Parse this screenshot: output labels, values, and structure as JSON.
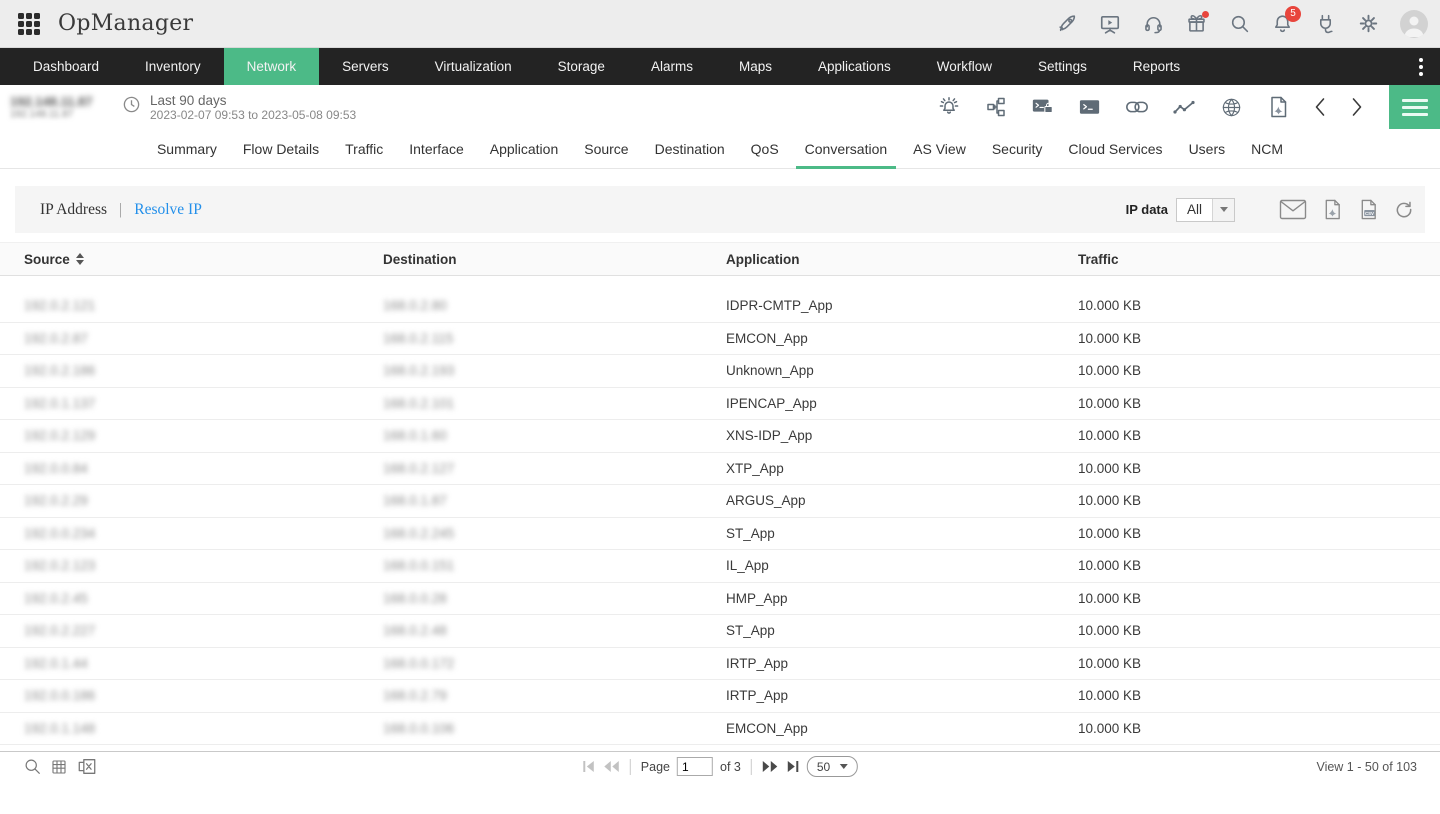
{
  "topbar": {
    "logo": "OpManager",
    "notification_count": "5",
    "icons": [
      "apps-grid-icon",
      "rocket-icon",
      "demo-video-icon",
      "support-headset-icon",
      "gift-icon",
      "search-icon",
      "notification-bell-icon",
      "integrations-plug-icon",
      "settings-gear-icon",
      "user-avatar"
    ]
  },
  "nav": {
    "items": [
      {
        "label": "Dashboard",
        "active": false
      },
      {
        "label": "Inventory",
        "active": false
      },
      {
        "label": "Network",
        "active": true
      },
      {
        "label": "Servers",
        "active": false
      },
      {
        "label": "Virtualization",
        "active": false
      },
      {
        "label": "Storage",
        "active": false
      },
      {
        "label": "Alarms",
        "active": false
      },
      {
        "label": "Maps",
        "active": false
      },
      {
        "label": "Applications",
        "active": false
      },
      {
        "label": "Workflow",
        "active": false
      },
      {
        "label": "Settings",
        "active": false
      },
      {
        "label": "Reports",
        "active": false
      }
    ]
  },
  "device": {
    "name": "192.148.11.87",
    "subtitle": "192.148.11.87",
    "masked": true
  },
  "period": {
    "label": "Last 90 days",
    "range": "2023-02-07 09:53 to 2023-05-08 09:53"
  },
  "subhead_icons": [
    "alarm-config-icon",
    "topology-icon",
    "secure-terminal-icon",
    "terminal-icon",
    "link-icon",
    "traffic-graph-icon",
    "globe-icon",
    "pdf-report-icon",
    "chevron-left-icon",
    "chevron-right-icon",
    "hamburger-menu-icon"
  ],
  "tabs": {
    "items": [
      "Summary",
      "Flow Details",
      "Traffic",
      "Interface",
      "Application",
      "Source",
      "Destination",
      "QoS",
      "Conversation",
      "AS View",
      "Security",
      "Cloud Services",
      "Users",
      "NCM"
    ],
    "active": "Conversation"
  },
  "filter": {
    "ip_address_label": "IP Address",
    "resolve_ip_label": "Resolve IP",
    "ip_data_label": "IP data",
    "ip_data_value": "All",
    "icons": [
      "mail-icon",
      "pdf-export-icon",
      "csv-export-icon",
      "refresh-icon"
    ]
  },
  "table": {
    "columns": [
      "Source",
      "Destination",
      "Application",
      "Traffic"
    ],
    "sorted_by": "Source",
    "masked_columns": [
      "Source",
      "Destination"
    ],
    "rows": [
      {
        "source": "192.0.2.121",
        "destination": "168.0.2.80",
        "application": "IDPR-CMTP_App",
        "traffic": "10.000 KB"
      },
      {
        "source": "192.0.2.87",
        "destination": "168.0.2.115",
        "application": "EMCON_App",
        "traffic": "10.000 KB"
      },
      {
        "source": "192.0.2.186",
        "destination": "168.0.2.193",
        "application": "Unknown_App",
        "traffic": "10.000 KB"
      },
      {
        "source": "192.0.1.137",
        "destination": "168.0.2.101",
        "application": "IPENCAP_App",
        "traffic": "10.000 KB"
      },
      {
        "source": "192.0.2.129",
        "destination": "168.0.1.60",
        "application": "XNS-IDP_App",
        "traffic": "10.000 KB"
      },
      {
        "source": "192.0.0.84",
        "destination": "168.0.2.127",
        "application": "XTP_App",
        "traffic": "10.000 KB"
      },
      {
        "source": "192.0.2.29",
        "destination": "168.0.1.87",
        "application": "ARGUS_App",
        "traffic": "10.000 KB"
      },
      {
        "source": "192.0.0.234",
        "destination": "168.0.2.245",
        "application": "ST_App",
        "traffic": "10.000 KB"
      },
      {
        "source": "192.0.2.123",
        "destination": "168.0.0.151",
        "application": "IL_App",
        "traffic": "10.000 KB"
      },
      {
        "source": "192.0.2.45",
        "destination": "168.0.0.28",
        "application": "HMP_App",
        "traffic": "10.000 KB"
      },
      {
        "source": "192.0.2.227",
        "destination": "168.0.2.48",
        "application": "ST_App",
        "traffic": "10.000 KB"
      },
      {
        "source": "192.0.1.44",
        "destination": "168.0.0.172",
        "application": "IRTP_App",
        "traffic": "10.000 KB"
      },
      {
        "source": "192.0.0.186",
        "destination": "168.0.2.79",
        "application": "IRTP_App",
        "traffic": "10.000 KB"
      },
      {
        "source": "192.0.1.148",
        "destination": "168.0.0.106",
        "application": "EMCON_App",
        "traffic": "10.000 KB"
      }
    ]
  },
  "footer": {
    "icons": [
      "footer-search-icon",
      "table-view-icon",
      "excel-export-icon"
    ],
    "page_label": "Page",
    "page_value": "1",
    "total_pages_label": "of 3",
    "page_size": "50",
    "view_text": "View 1 - 50 of 103"
  }
}
